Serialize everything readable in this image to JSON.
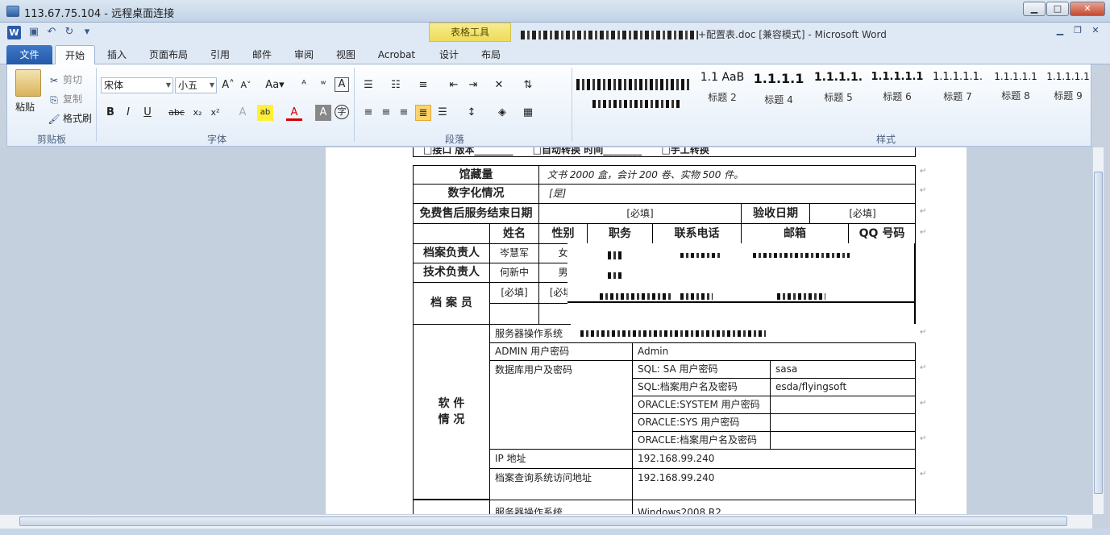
{
  "remote": {
    "title": "113.67.75.104 - 远程桌面连接"
  },
  "word": {
    "context_tab_group": "表格工具",
    "doc_title_suffix": "+配置表.doc [兼容模式] - Microsoft Word"
  },
  "tabs": [
    "文件",
    "开始",
    "插入",
    "页面布局",
    "引用",
    "邮件",
    "审阅",
    "视图",
    "Acrobat",
    "设计",
    "布局"
  ],
  "clipboard": {
    "paste": "粘贴",
    "cut": "剪切",
    "copy": "复制",
    "format_painter": "格式刷",
    "group": "剪贴板"
  },
  "font": {
    "name": "宋体",
    "size": "小五",
    "group": "字体"
  },
  "paragraph": {
    "group": "段落"
  },
  "styles": {
    "group": "样式",
    "items": [
      {
        "prev": "1.1 AaB",
        "name": "标题 2"
      },
      {
        "prev": "1.1.1.1",
        "name": "标题 4"
      },
      {
        "prev": "1.1.1.1.",
        "name": "标题 5"
      },
      {
        "prev": "1.1.1.1.1",
        "name": "标题 6"
      },
      {
        "prev": "1.1.1.1.1.",
        "name": "标题 7"
      },
      {
        "prev": "1.1.1.1.1",
        "name": "标题 8"
      },
      {
        "prev": "1.1.1.1.1",
        "name": "标题 9"
      }
    ]
  },
  "doc": {
    "row0": {
      "a": "□接口  版本________",
      "b": "□自动转换  时间________",
      "c": "□手工转换"
    },
    "collection_label": "馆藏量",
    "collection_value": "文书 2000 盒，会计 200 卷、实物 500 件。",
    "digital_label": "数字化情况",
    "digital_value": "[是]",
    "aftersales_label": "免费售后服务结束日期",
    "required": "[必填]",
    "accept_label": "验收日期",
    "headers": {
      "name": "姓名",
      "gender": "性别",
      "position": "职务",
      "phone": "联系电话",
      "email": "邮箱",
      "qq": "QQ 号码"
    },
    "archive_lead": {
      "label": "档案负责人",
      "name": "岑慧军",
      "gender": "女"
    },
    "tech_lead": {
      "label": "技术负责人",
      "name": "何新中",
      "gender": "男"
    },
    "clerk": {
      "label": "档  案  员",
      "name": "[必填]",
      "gender": "[必填]"
    },
    "software": {
      "label": "软    件\n情    况",
      "os": "服务器操作系统",
      "admin_label": "ADMIN 用户密码",
      "admin_value": "Admin",
      "db_label": "数据库用户及密码",
      "db_rows": [
        {
          "k": "SQL:  SA 用户密码",
          "v": "sasa"
        },
        {
          "k": "SQL:档案用户名及密码",
          "v": "esda/flyingsoft"
        },
        {
          "k": "ORACLE:SYSTEM 用户密码",
          "v": ""
        },
        {
          "k": "ORACLE:SYS 用户密码",
          "v": ""
        },
        {
          "k": "ORACLE:档案用户名及密码",
          "v": ""
        }
      ],
      "ip_label": "IP 地址",
      "ip_value": "192.168.99.240",
      "query_label": "档案查询系统访问地址",
      "query_value": "192.168.99.240",
      "os2_label": "服务器操作系统",
      "os2_value": "Windows2008 R2"
    }
  }
}
